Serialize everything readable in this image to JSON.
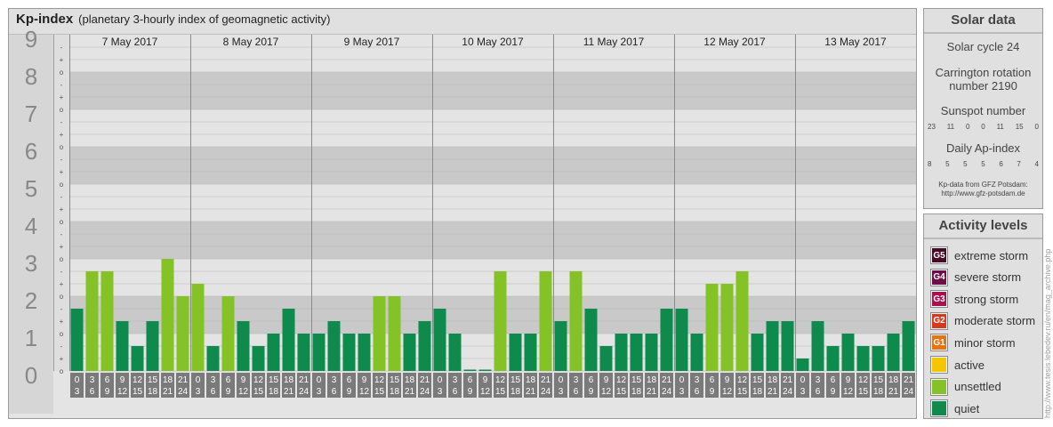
{
  "header": {
    "title": "Kp-index",
    "subtitle": "(planetary 3-hourly index of geomagnetic activity)"
  },
  "colors": {
    "quiet": "#0e8a4c",
    "unsettled": "#85c226",
    "active": "#f6c400",
    "minor_storm": "#e8730e",
    "moderate_storm": "#d63a1e",
    "strong_storm": "#a8104f",
    "severe_storm": "#6e0e46",
    "extreme_storm": "#4a0822"
  },
  "chart_data": {
    "type": "bar",
    "title": "Kp-index",
    "y_ticks": [
      "0",
      "1",
      "2",
      "3",
      "4",
      "5",
      "6",
      "7",
      "8",
      "9"
    ],
    "sub_ticks": [
      "o",
      "+",
      "-"
    ],
    "ylim": [
      0,
      9
    ],
    "days": [
      "7 May 2017",
      "8 May 2017",
      "9 May 2017",
      "10 May 2017",
      "11 May 2017",
      "12 May 2017",
      "13 May 2017"
    ],
    "interval_starts": [
      "0",
      "3",
      "6",
      "9",
      "12",
      "15",
      "18",
      "21"
    ],
    "interval_ends": [
      "3",
      "6",
      "9",
      "12",
      "15",
      "18",
      "21",
      "24"
    ],
    "values": [
      1.667,
      2.667,
      2.667,
      1.333,
      0.667,
      1.333,
      3.0,
      2.0,
      2.333,
      0.667,
      2.0,
      1.333,
      0.667,
      1.0,
      1.667,
      1.0,
      1.0,
      1.333,
      1.0,
      1.0,
      2.0,
      2.0,
      1.0,
      1.333,
      1.667,
      1.0,
      0.0,
      0.0,
      2.667,
      1.0,
      1.0,
      2.667,
      1.333,
      2.667,
      1.667,
      0.667,
      1.0,
      1.0,
      1.0,
      1.667,
      1.667,
      1.0,
      2.333,
      2.333,
      2.667,
      1.0,
      1.333,
      1.333,
      0.333,
      1.333,
      0.667,
      1.0,
      0.667,
      0.667,
      1.0,
      1.333
    ]
  },
  "solar": {
    "title": "Solar data",
    "cycle": "Solar cycle 24",
    "carrington_line1": "Carrington rotation",
    "carrington_line2": "number 2190",
    "sunspot_title": "Sunspot number",
    "sunspot_values": [
      "23",
      "11",
      "0",
      "0",
      "11",
      "15",
      "0"
    ],
    "ap_title": "Daily Ap-index",
    "ap_values": [
      "8",
      "5",
      "5",
      "5",
      "6",
      "7",
      "4"
    ],
    "source_line1": "Kp-data from GFZ Potsdam:",
    "source_line2": "http://www.gfz-potsdam.de"
  },
  "activity": {
    "title": "Activity levels",
    "items": [
      {
        "code": "G5",
        "label": "extreme storm",
        "color": "#4a0822"
      },
      {
        "code": "G4",
        "label": "severe storm",
        "color": "#6e0e46"
      },
      {
        "code": "G3",
        "label": "strong storm",
        "color": "#a8104f"
      },
      {
        "code": "G2",
        "label": "moderate storm",
        "color": "#d63a1e"
      },
      {
        "code": "G1",
        "label": "minor storm",
        "color": "#e8730e"
      },
      {
        "code": "",
        "label": "active",
        "color": "#f6c400"
      },
      {
        "code": "",
        "label": "unsettled",
        "color": "#85c226"
      },
      {
        "code": "",
        "label": "quiet",
        "color": "#0e8a4c"
      }
    ]
  },
  "watermark": "http://www.tesis.lebedev.ru/en/mag_archive.php"
}
